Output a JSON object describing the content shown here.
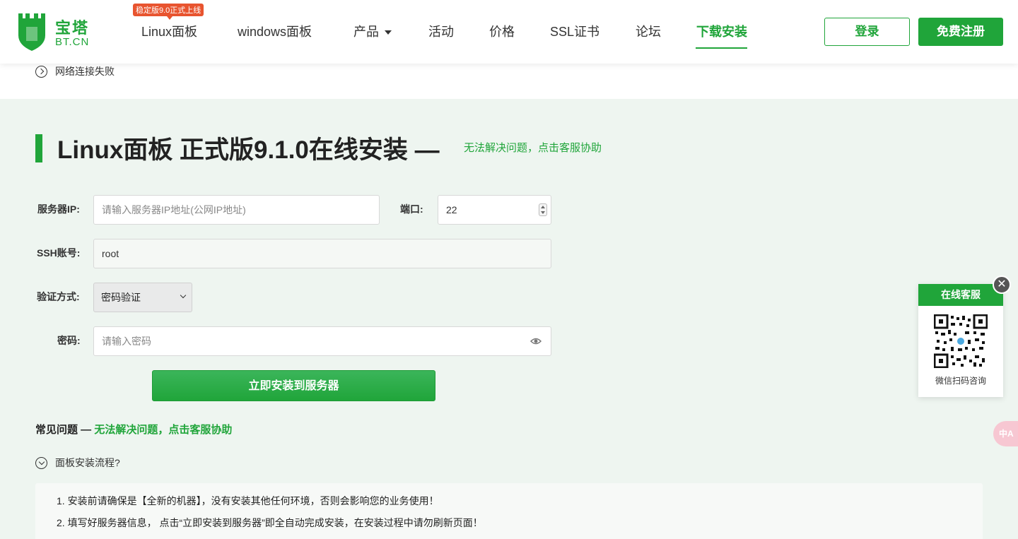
{
  "header": {
    "logo_cn": "宝塔",
    "logo_en": "BT.CN",
    "badge": "稳定版9.0正式上线",
    "nav": [
      {
        "label": "Linux面板"
      },
      {
        "label": "windows面板"
      },
      {
        "label": "产品"
      },
      {
        "label": "活动"
      },
      {
        "label": "价格"
      },
      {
        "label": "SSL证书"
      },
      {
        "label": "论坛"
      },
      {
        "label": "下载安装"
      }
    ],
    "active_nav": "下载安装",
    "login": "登录",
    "register": "免费注册"
  },
  "notice": {
    "text": "网络连接失败"
  },
  "main": {
    "title": "Linux面板 正式版9.1.0在线安装 —",
    "help_link": "无法解决问题，点击客服协助",
    "form": {
      "ip_label": "服务器IP:",
      "ip_placeholder": "请输入服务器IP地址(公网IP地址)",
      "port_label": "端口:",
      "port_value": "22",
      "ssh_label": "SSH账号:",
      "ssh_value": "root",
      "auth_label": "验证方式:",
      "auth_value": "密码验证",
      "password_label": "密码:",
      "password_placeholder": "请输入密码",
      "submit": "立即安装到服务器"
    },
    "faq": {
      "title": "常见问题 —",
      "help_link": "无法解决问题，点击客服协助",
      "item_title": "面板安装流程?",
      "lines": [
        "1. 安装前请确保是【全新的机器】，没有安装其他任何环境，否则会影响您的业务使用！",
        "2. 填写好服务器信息，  点击“立即安装到服务器”即全自动完成安装，在安装过程中请勿刷新页面！"
      ]
    }
  },
  "service": {
    "title": "在线客服",
    "caption": "微信扫码咨询",
    "close": "✕",
    "translate": "中A"
  },
  "colors": {
    "brand": "#20a53a",
    "badge": "#e8542f",
    "section_bg": "#eef5f0"
  }
}
